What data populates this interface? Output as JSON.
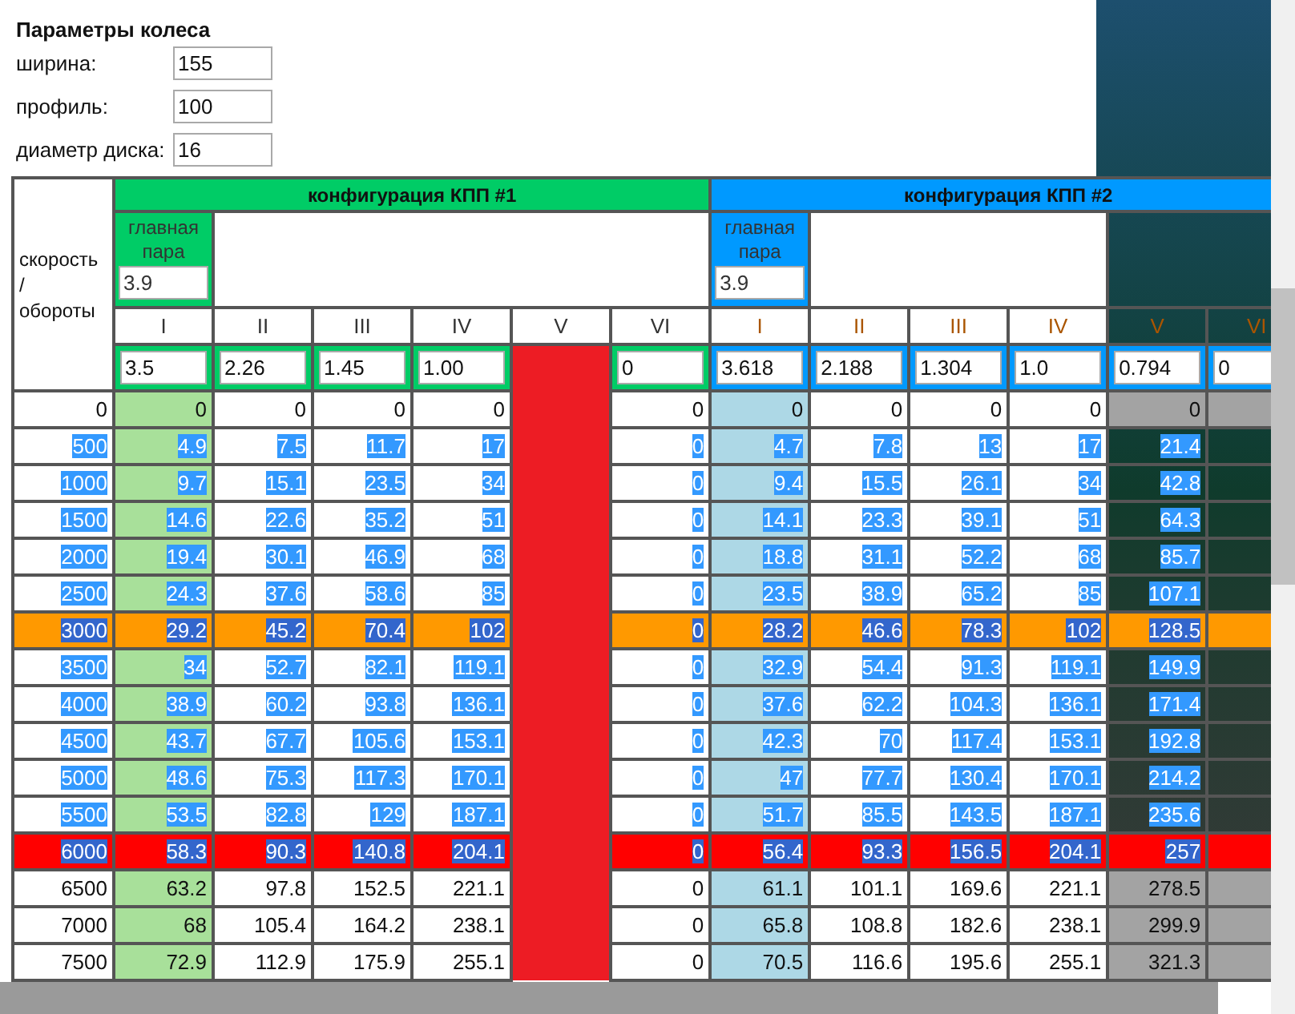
{
  "wheel": {
    "title": "Параметры колеса",
    "fields": [
      {
        "label": "ширина:",
        "value": "155"
      },
      {
        "label": "профиль:",
        "value": "100"
      },
      {
        "label": "диаметр диска:",
        "value": "16"
      }
    ]
  },
  "corner_header": "скорость\n/\nобороты",
  "gearboxes": [
    {
      "title": "конфигурация КПП #1",
      "color": "#00cc66",
      "main_pair_label": "главная пара",
      "main_pair": "3.9",
      "gears": [
        {
          "numeral": "I",
          "ratio": "3.5",
          "redacted": false
        },
        {
          "numeral": "II",
          "ratio": "2.26",
          "redacted": false
        },
        {
          "numeral": "III",
          "ratio": "1.45",
          "redacted": false
        },
        {
          "numeral": "IV",
          "ratio": "1.00",
          "redacted": false
        },
        {
          "numeral": "V",
          "redacted": true
        },
        {
          "numeral": "VI",
          "ratio": "0",
          "redacted": false
        }
      ]
    },
    {
      "title": "конфигурация КПП #2",
      "color": "#0099ff",
      "main_pair_label": "главная пара",
      "main_pair": "3.9",
      "gears": [
        {
          "numeral": "I",
          "ratio": "3.618",
          "redacted": false
        },
        {
          "numeral": "II",
          "ratio": "2.188",
          "redacted": false
        },
        {
          "numeral": "III",
          "ratio": "1.304",
          "redacted": false
        },
        {
          "numeral": "IV",
          "ratio": "1.0",
          "redacted": false
        },
        {
          "numeral": "V",
          "ratio": "0.794",
          "redacted": false
        },
        {
          "numeral": "VI",
          "ratio": "0",
          "redacted": false
        }
      ]
    }
  ],
  "rows": [
    {
      "rpm": "0",
      "selected": false,
      "values": [
        [
          "0",
          "0",
          "0",
          "0",
          "0"
        ],
        [
          "0",
          "0",
          "0",
          "0",
          "0"
        ]
      ]
    },
    {
      "rpm": "500",
      "selected": true,
      "values": [
        [
          "4.9",
          "7.5",
          "11.7",
          "17",
          "0"
        ],
        [
          "4.7",
          "7.8",
          "13",
          "17",
          "21.4"
        ]
      ]
    },
    {
      "rpm": "1000",
      "selected": true,
      "values": [
        [
          "9.7",
          "15.1",
          "23.5",
          "34",
          "0"
        ],
        [
          "9.4",
          "15.5",
          "26.1",
          "34",
          "42.8"
        ]
      ]
    },
    {
      "rpm": "1500",
      "selected": true,
      "values": [
        [
          "14.6",
          "22.6",
          "35.2",
          "51",
          "0"
        ],
        [
          "14.1",
          "23.3",
          "39.1",
          "51",
          "64.3"
        ]
      ]
    },
    {
      "rpm": "2000",
      "selected": true,
      "values": [
        [
          "19.4",
          "30.1",
          "46.9",
          "68",
          "0"
        ],
        [
          "18.8",
          "31.1",
          "52.2",
          "68",
          "85.7"
        ]
      ]
    },
    {
      "rpm": "2500",
      "selected": true,
      "values": [
        [
          "24.3",
          "37.6",
          "58.6",
          "85",
          "0"
        ],
        [
          "23.5",
          "38.9",
          "65.2",
          "85",
          "107.1"
        ]
      ]
    },
    {
      "rpm": "3000",
      "selected": true,
      "color": "#ff9900",
      "values": [
        [
          "29.2",
          "45.2",
          "70.4",
          "102",
          "0"
        ],
        [
          "28.2",
          "46.6",
          "78.3",
          "102",
          "128.5"
        ]
      ]
    },
    {
      "rpm": "3500",
      "selected": true,
      "values": [
        [
          "34",
          "52.7",
          "82.1",
          "119.1",
          "0"
        ],
        [
          "32.9",
          "54.4",
          "91.3",
          "119.1",
          "149.9"
        ]
      ]
    },
    {
      "rpm": "4000",
      "selected": true,
      "values": [
        [
          "38.9",
          "60.2",
          "93.8",
          "136.1",
          "0"
        ],
        [
          "37.6",
          "62.2",
          "104.3",
          "136.1",
          "171.4"
        ]
      ]
    },
    {
      "rpm": "4500",
      "selected": true,
      "values": [
        [
          "43.7",
          "67.7",
          "105.6",
          "153.1",
          "0"
        ],
        [
          "42.3",
          "70",
          "117.4",
          "153.1",
          "192.8"
        ]
      ]
    },
    {
      "rpm": "5000",
      "selected": true,
      "values": [
        [
          "48.6",
          "75.3",
          "117.3",
          "170.1",
          "0"
        ],
        [
          "47",
          "77.7",
          "130.4",
          "170.1",
          "214.2"
        ]
      ]
    },
    {
      "rpm": "5500",
      "selected": true,
      "values": [
        [
          "53.5",
          "82.8",
          "129",
          "187.1",
          "0"
        ],
        [
          "51.7",
          "85.5",
          "143.5",
          "187.1",
          "235.6"
        ]
      ]
    },
    {
      "rpm": "6000",
      "selected": true,
      "color": "#ff0000",
      "values": [
        [
          "58.3",
          "90.3",
          "140.8",
          "204.1",
          "0"
        ],
        [
          "56.4",
          "93.3",
          "156.5",
          "204.1",
          "257"
        ]
      ]
    },
    {
      "rpm": "6500",
      "selected": false,
      "values": [
        [
          "63.2",
          "97.8",
          "152.5",
          "221.1",
          "0"
        ],
        [
          "61.1",
          "101.1",
          "169.6",
          "221.1",
          "278.5"
        ]
      ]
    },
    {
      "rpm": "7000",
      "selected": false,
      "values": [
        [
          "68",
          "105.4",
          "164.2",
          "238.1",
          "0"
        ],
        [
          "65.8",
          "108.8",
          "182.6",
          "238.1",
          "299.9"
        ]
      ]
    },
    {
      "rpm": "7500",
      "selected": false,
      "values": [
        [
          "72.9",
          "112.9",
          "175.9",
          "255.1",
          "0"
        ],
        [
          "70.5",
          "116.6",
          "195.6",
          "255.1",
          "321.3"
        ]
      ]
    }
  ]
}
